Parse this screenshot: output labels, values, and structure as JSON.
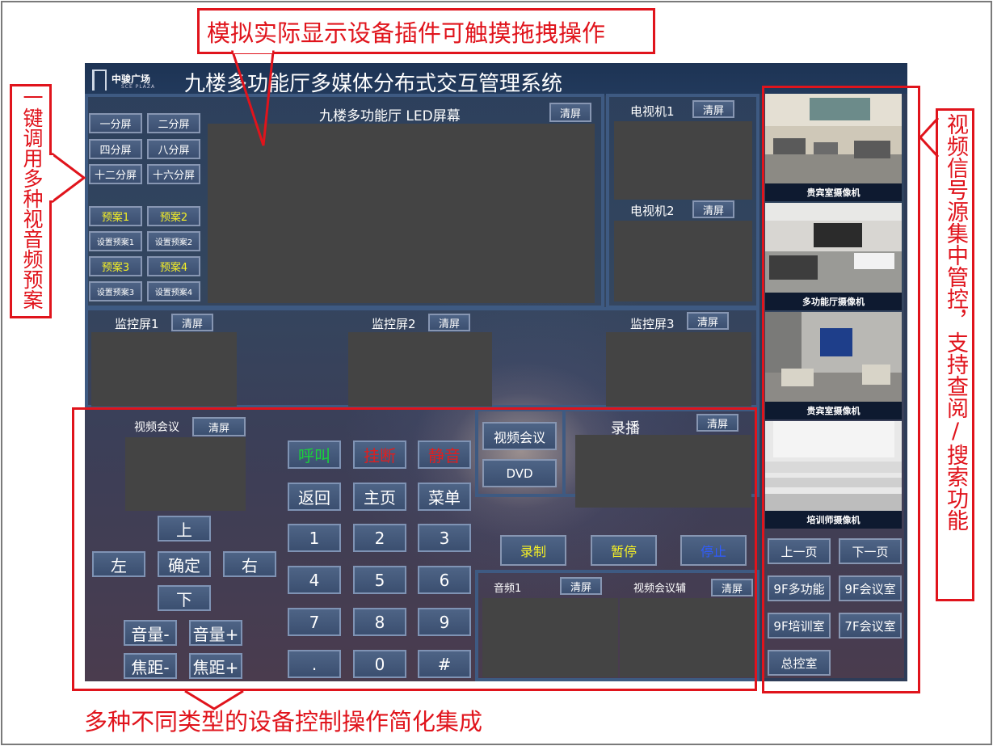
{
  "app": {
    "title": "九楼多功能厅多媒体分布式交互管理系统",
    "logo_cn": "中骏广场",
    "logo_en": "SCE PLAZA"
  },
  "annotations": {
    "top": "模拟实际显示设备插件可触摸拖拽操作",
    "left": "一键调用多种视音频预案",
    "right": "视频信号源集中管控，支持查阅/搜索功能",
    "bottom": "多种不同类型的设备控制操作简化集成"
  },
  "clear_label": "清屏",
  "layout_buttons": [
    "一分屏",
    "二分屏",
    "四分屏",
    "八分屏",
    "十二分屏",
    "十六分屏"
  ],
  "presets": [
    {
      "name": "预案1",
      "set": "设置预案1"
    },
    {
      "name": "预案2",
      "set": "设置预案2"
    },
    {
      "name": "预案3",
      "set": "设置预案3"
    },
    {
      "name": "预案4",
      "set": "设置预案4"
    }
  ],
  "led": {
    "title": "九楼多功能厅 LED屏幕"
  },
  "tv": [
    "电视机1",
    "电视机2"
  ],
  "monitors": [
    "监控屏1",
    "监控屏2",
    "监控屏3"
  ],
  "vc": {
    "title": "视频会议",
    "call": "呼叫",
    "hangup": "挂断",
    "mute": "静音",
    "back": "返回",
    "home": "主页",
    "menu": "菜单",
    "up": "上",
    "down": "下",
    "left": "左",
    "right": "右",
    "ok": "确定",
    "vol_minus": "音量-",
    "vol_plus": "音量+",
    "focus_minus": "焦距-",
    "focus_plus": "焦距+",
    "keys": [
      "1",
      "2",
      "3",
      "4",
      "5",
      "6",
      "7",
      "8",
      "9",
      ".",
      "0",
      "#"
    ]
  },
  "source": {
    "vc": "视频会议",
    "dvd": "DVD"
  },
  "record": {
    "title": "录播",
    "rec": "录制",
    "pause": "暂停",
    "stop": "停止"
  },
  "audio": {
    "a1": "音频1",
    "vc_aux": "视频会议辅"
  },
  "cameras": [
    "贵宾室摄像机",
    "多功能厅摄像机",
    "贵宾室摄像机",
    "培训师摄像机"
  ],
  "pager": {
    "prev": "上一页",
    "next": "下一页"
  },
  "rooms": [
    "9F多功能",
    "9F会议室",
    "9F培训室",
    "7F会议室",
    "总控室"
  ],
  "colors": {
    "call": "#19d43a",
    "hangup": "#e01e1e",
    "mute": "#e01e1e",
    "preset": "#f6f025",
    "stop": "#2f5cff",
    "annotation": "#e0141c"
  }
}
